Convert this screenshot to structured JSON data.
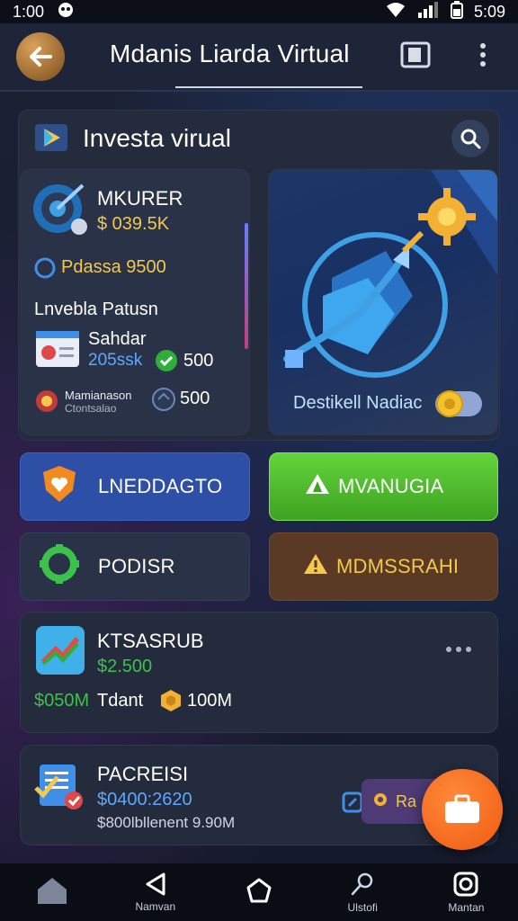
{
  "status_bar": {
    "time_left": "1:00",
    "time_right": "5:09"
  },
  "header": {
    "title": "Mdanis Liarda Virtual"
  },
  "panel": {
    "title": "Investa virual",
    "left_card": {
      "heading": "MKURER",
      "amount": "$ 039.5K",
      "stat_line": "Pdassa 9500",
      "section_label": "Lnvebla Patusn",
      "item_name": "Sahdar",
      "item_value": "205ssk",
      "item_badge": "500",
      "footer_line1": "Mamianason",
      "footer_line2": "Ctontsalao",
      "footer_value": "500"
    },
    "right_card": {
      "caption": "Destikell Nadiac"
    }
  },
  "buttons": {
    "blue": "LNEDDAGTO",
    "green": "MVANUGIA",
    "dark": "PODISR",
    "brown": "MDMSSRAHI"
  },
  "list": [
    {
      "title": "KTSASRUB",
      "amount": "$2.500",
      "meta_left": "$050M",
      "meta_mid": "Tdant",
      "meta_right": "100M"
    },
    {
      "title": "PACREISI",
      "amount": "$0400:2620",
      "meta": "$800lbllenent 9.90M",
      "tag": "Ra"
    }
  ],
  "bottom_nav": [
    {
      "label": ""
    },
    {
      "label": "Namvan"
    },
    {
      "label": ""
    },
    {
      "label": "Ulstofi"
    },
    {
      "label": "Mantan"
    }
  ]
}
